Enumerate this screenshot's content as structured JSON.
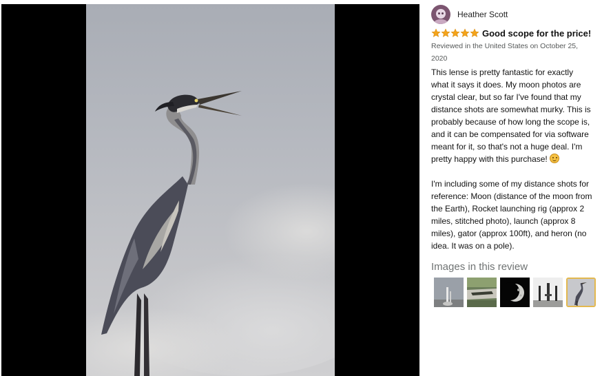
{
  "viewer": {
    "image_subject": "heron-photo",
    "background_color": "#000000"
  },
  "review": {
    "reviewer_name": "Heather Scott",
    "rating": 5,
    "rating_max": 5,
    "star_color": "#f4a41c",
    "title": "Good scope for the price!",
    "date_line_1": "Reviewed in the United States on October 25,",
    "date_line_2": "2020",
    "body_paragraph_1": "This lense is pretty fantastic for exactly\nwhat it says it does. My moon photos are\ncrystal clear, but so far I've found that my\ndistance shots are somewhat murky. This is\nprobably because of how long the scope is,\nand it can be compensated for via software\nmeant for it, so that's not a huge deal. I'm\npretty happy with this purchase!",
    "body_emoji": "smiling-face-icon",
    "body_paragraph_2": "I'm including some of my distance shots for\nreference: Moon (distance of the moon from\nthe Earth), Rocket launching rig (approx 2\nmiles, stitched photo), launch (approx 8\nmiles), gator (approx 100ft), and heron (no\nidea. It was on a pole)."
  },
  "images_section": {
    "heading": "Images in this review",
    "selected_index": 4,
    "selected_border_color": "#e3b84e",
    "thumbnails": [
      {
        "subject": "rocket-launch-thumbnail"
      },
      {
        "subject": "gator-thumbnail"
      },
      {
        "subject": "moon-thumbnail"
      },
      {
        "subject": "launch-rig-thumbnail"
      },
      {
        "subject": "heron-thumbnail"
      }
    ]
  }
}
